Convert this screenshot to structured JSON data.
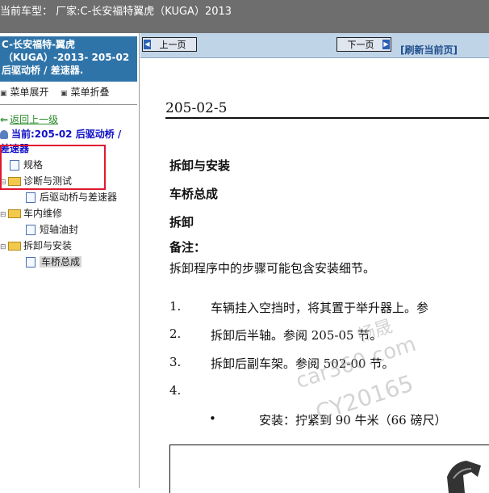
{
  "window": {
    "title": "当前车型：  厂家:C-长安福特翼虎（KUGA）2013"
  },
  "sidebar": {
    "vehicle_line1": "C-长安福特-翼虎",
    "vehicle_line2": "（KUGA）-2013- 205-02",
    "vehicle_line3": "后驱动桥 / 差速器.",
    "expand_label": "菜单展开",
    "collapse_label": "菜单折叠",
    "back_label": "返回上一级",
    "current_line1": "当前:205-02 后驱动桥 /",
    "current_line2": "差速器",
    "tree": {
      "spec": "规格",
      "diag_folder": "诊断与测试",
      "diag_item": "后驱动桥与差速器",
      "invehicle_folder": "车内维修",
      "invehicle_item": "短轴油封",
      "removal_folder": "拆卸与安装",
      "removal_item": "车桥总成"
    }
  },
  "nav": {
    "prev_label": "上一页",
    "next_label": "下一页",
    "refresh_label": "[刷新当前页]"
  },
  "document": {
    "section_number": "205-02-5",
    "heading_main": "拆卸与安装",
    "heading_sub": "车桥总成",
    "heading_removal": "拆卸",
    "note_label": "备注：",
    "note_text": "拆卸程序中的步骤可能包含安装细节。",
    "steps": [
      {
        "num": "1.",
        "text": "车辆挂入空挡时，将其置于举升器上。参"
      },
      {
        "num": "2.",
        "text": "拆卸后半轴。参阅 205-05 节。"
      },
      {
        "num": "3.",
        "text": "拆卸后副车架。参阅 502-00 节。"
      },
      {
        "num": "4.",
        "text": ""
      }
    ],
    "bullet_symbol": "•",
    "bullet_text": "安装：拧紧到 90 牛米（66 磅尺）"
  },
  "watermark": {
    "line1": "畅晟",
    "line2": "car360.com",
    "line3": "CY20165"
  }
}
